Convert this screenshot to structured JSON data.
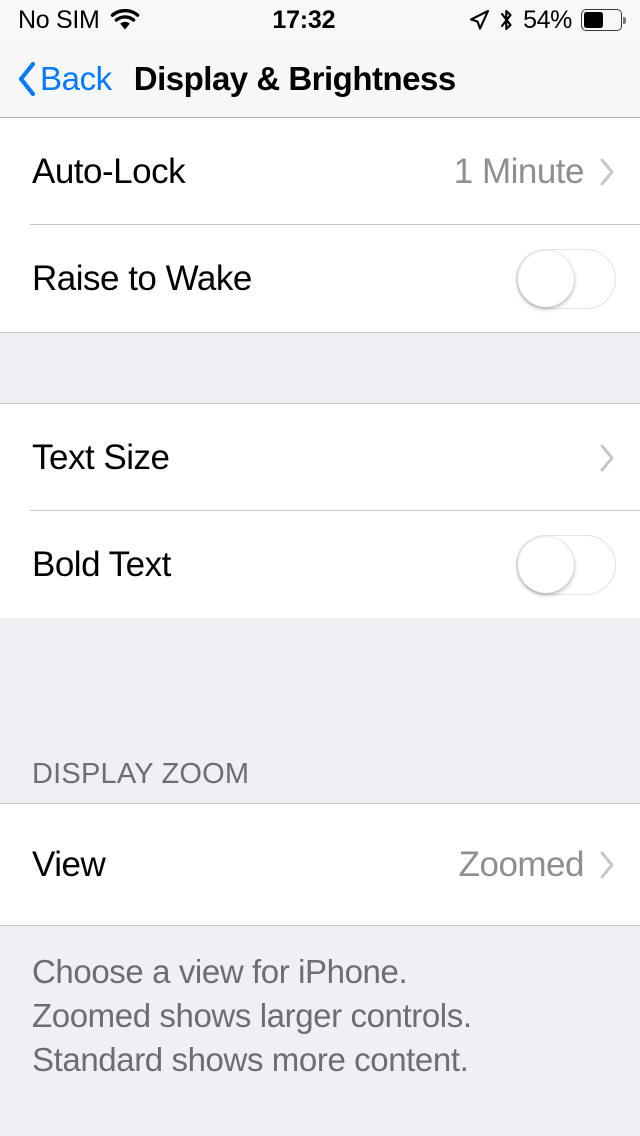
{
  "status_bar": {
    "carrier": "No SIM",
    "wifi_icon": "wifi-icon",
    "time": "17:32",
    "location_icon": "location-arrow-icon",
    "bluetooth_icon": "bluetooth-icon",
    "battery_percent_label": "54%",
    "battery_level": 54,
    "battery_icon": "battery-icon"
  },
  "nav_bar": {
    "back_label": "Back",
    "back_icon": "chevron-left-icon",
    "title": "Display & Brightness",
    "accent_color": "#007AFF"
  },
  "sections": [
    {
      "header": "",
      "rows": [
        {
          "label": "Auto-Lock",
          "value": "1 Minute",
          "accessory": "chevron",
          "name": "auto-lock"
        },
        {
          "label": "Raise to Wake",
          "value": "",
          "accessory": "toggle",
          "toggle_on": false,
          "name": "raise-to-wake"
        }
      ],
      "footer": ""
    },
    {
      "header": "",
      "rows": [
        {
          "label": "Text Size",
          "value": "",
          "accessory": "chevron",
          "name": "text-size"
        },
        {
          "label": "Bold Text",
          "value": "",
          "accessory": "toggle",
          "toggle_on": false,
          "name": "bold-text"
        }
      ],
      "footer": ""
    },
    {
      "header": "DISPLAY ZOOM",
      "rows": [
        {
          "label": "View",
          "value": "Zoomed",
          "accessory": "chevron",
          "name": "view"
        }
      ],
      "footer_lines": [
        "Choose a view for iPhone.",
        "Zoomed shows larger controls.",
        "Standard shows more content."
      ]
    }
  ],
  "colors": {
    "accent": "#007AFF",
    "group_background": "#EFEFF4",
    "row_background": "#FFFFFF",
    "secondary_text": "#8E8E93",
    "header_text": "#6D6D72",
    "separator": "#C8C7CC"
  }
}
